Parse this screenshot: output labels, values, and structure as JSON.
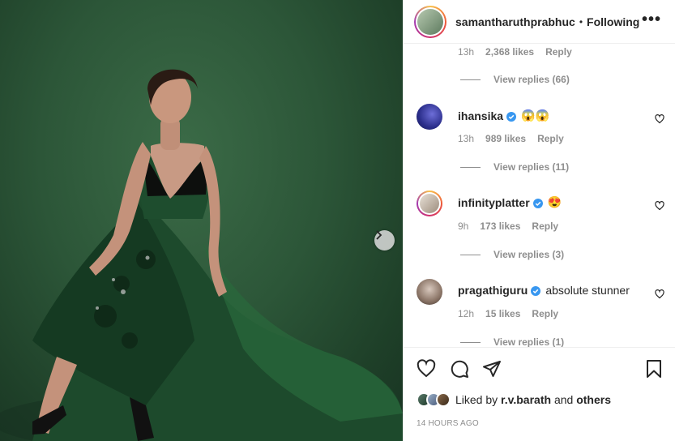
{
  "post": {
    "username": "samantharuthprabhuc",
    "separator": "•",
    "follow_status": "Following",
    "more_label": "•••",
    "likes_summary_prefix": "Liked by",
    "likes_summary_user": "r.v.barath",
    "likes_summary_and": "and",
    "likes_summary_others": "others",
    "timestamp": "14 HOURS AGO"
  },
  "top_partial": {
    "time": "13h",
    "likes": "2,368 likes",
    "reply": "Reply",
    "view_replies": "View replies (66)"
  },
  "comments": [
    {
      "username": "ihansika",
      "verified": true,
      "text": "😱😱",
      "time": "13h",
      "likes": "989 likes",
      "reply": "Reply",
      "view_replies": "View replies (11)"
    },
    {
      "username": "infinityplatter",
      "verified": true,
      "text": "😍",
      "time": "9h",
      "likes": "173 likes",
      "reply": "Reply",
      "view_replies": "View replies (3)"
    },
    {
      "username": "pragathiguru",
      "verified": true,
      "text": "absolute stunner",
      "time": "12h",
      "likes": "15 likes",
      "reply": "Reply",
      "view_replies": "View replies (1)"
    }
  ],
  "icons": {
    "like": "heart-icon",
    "comment": "comment-icon",
    "share": "share-icon",
    "save": "bookmark-icon",
    "next": "chevron-right-icon",
    "verified": "verified-badge-icon"
  },
  "colors": {
    "photo_bg": "#2c5638",
    "verified": "#3897f0",
    "muted_text": "#8e8e8e",
    "primary_text": "#262626"
  }
}
